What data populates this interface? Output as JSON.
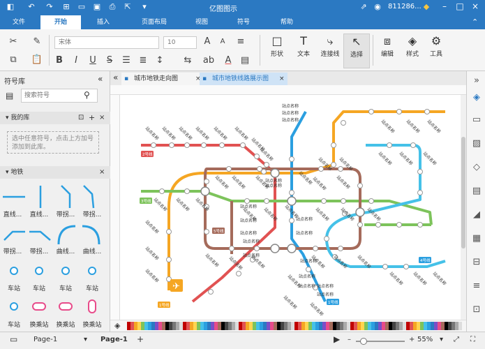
{
  "app": {
    "title": "亿图图示",
    "user": "811286..."
  },
  "menu": {
    "tabs": [
      "文件",
      "开始",
      "插入",
      "页面布局",
      "视图",
      "符号",
      "帮助"
    ],
    "active": "开始"
  },
  "ribbon": {
    "font_name": "宋体",
    "font_size": "10",
    "tools": [
      "形状",
      "文本",
      "连接线",
      "选择",
      "编辑",
      "样式",
      "工具"
    ],
    "selected_tool": "选择"
  },
  "left_panel": {
    "title": "符号库",
    "search_placeholder": "搜索符号",
    "my_lib": {
      "title": "我的库",
      "hint": "选中任意符号，点击上方加号添加到此库。"
    },
    "subway": {
      "title": "地铁",
      "shapes": [
        "直线...",
        "直线...",
        "带拐...",
        "带拐...",
        "带拐...",
        "带拐...",
        "曲线...",
        "曲线...",
        "车站",
        "车站",
        "车站",
        "车站",
        "车站",
        "换乘站",
        "换乘站",
        "换乘站"
      ]
    }
  },
  "doc_tabs": [
    "城市地铁走向图",
    "城市地铁线路展示图"
  ],
  "active_doc": "城市地铁线路展示图",
  "map": {
    "station_label": "站点名称",
    "line_labels": [
      "2号线",
      "3号线",
      "5号线",
      "1号线",
      "4号线"
    ],
    "colors": {
      "red": "#e15252",
      "orange": "#f5a623",
      "blue": "#2b9fe0",
      "green": "#7dc35b",
      "brown": "#a56b5b",
      "cyan": "#45c1e8"
    }
  },
  "status": {
    "page_select": "Page-1",
    "page_tab": "Page-1",
    "add": "+",
    "zoom": "55%"
  }
}
